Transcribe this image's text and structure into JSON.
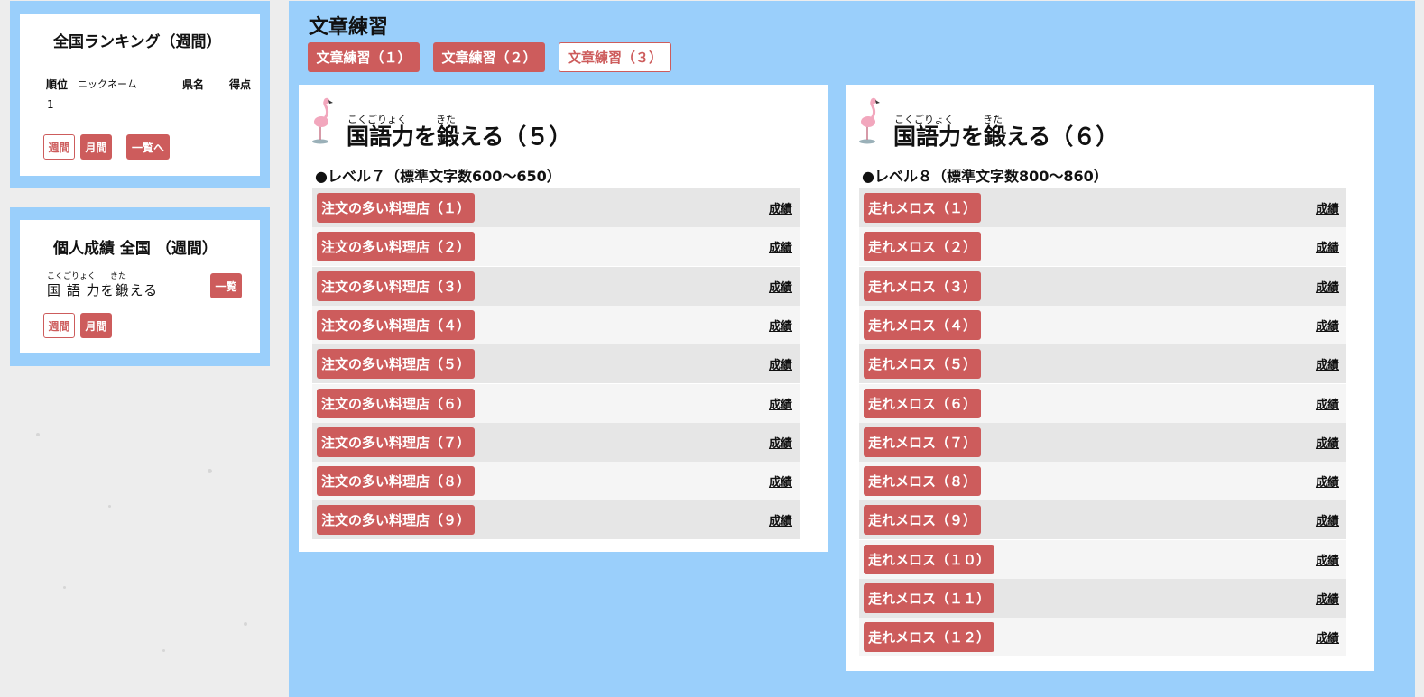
{
  "ranking": {
    "title": "全国ランキング（週間）",
    "columns": [
      "順位",
      "ニックネーム",
      "県名",
      "得点"
    ],
    "rows": [
      {
        "rank": "1",
        "nickname": "",
        "prefecture": "",
        "score": ""
      }
    ],
    "buttons": {
      "weekly": "週間",
      "monthly": "月間",
      "list": "一覧へ"
    }
  },
  "personal": {
    "title": "個人成績 全国 （週間）",
    "course_ruby": {
      "r1": "こくごりょく",
      "r2": "きた"
    },
    "course_name": "国 語 力を鍛える",
    "list_button": "一覧",
    "buttons": {
      "weekly": "週間",
      "monthly": "月間"
    }
  },
  "main": {
    "title": "文章練習",
    "tabs": [
      {
        "label": "文章練習（１）",
        "active": false
      },
      {
        "label": "文章練習（２）",
        "active": false
      },
      {
        "label": "文章練習（３）",
        "active": true
      }
    ]
  },
  "cards": [
    {
      "ruby1": "こくごりょく",
      "ruby2": "きた",
      "title": "国語力を鍛える（５）",
      "level": "●レベル７（標準文字数600～650）",
      "score_label": "成績",
      "lessons": [
        "注文の多い料理店（１）",
        "注文の多い料理店（２）",
        "注文の多い料理店（３）",
        "注文の多い料理店（４）",
        "注文の多い料理店（５）",
        "注文の多い料理店（６）",
        "注文の多い料理店（７）",
        "注文の多い料理店（８）",
        "注文の多い料理店（９）"
      ]
    },
    {
      "ruby1": "こくごりょく",
      "ruby2": "きた",
      "title": "国語力を鍛える（６）",
      "level": "●レベル８（標準文字数800～860）",
      "score_label": "成績",
      "lessons": [
        "走れメロス（１）",
        "走れメロス（２）",
        "走れメロス（３）",
        "走れメロス（４）",
        "走れメロス（５）",
        "走れメロス（６）",
        "走れメロス（７）",
        "走れメロス（８）",
        "走れメロス（９）",
        "走れメロス（１０）",
        "走れメロス（１１）",
        "走れメロス（１２）"
      ]
    }
  ],
  "colors": {
    "accent": "#cd5c5c",
    "panel": "#9acffb",
    "row_alt1": "#e6e6e6",
    "row_alt2": "#f5f5f5"
  }
}
